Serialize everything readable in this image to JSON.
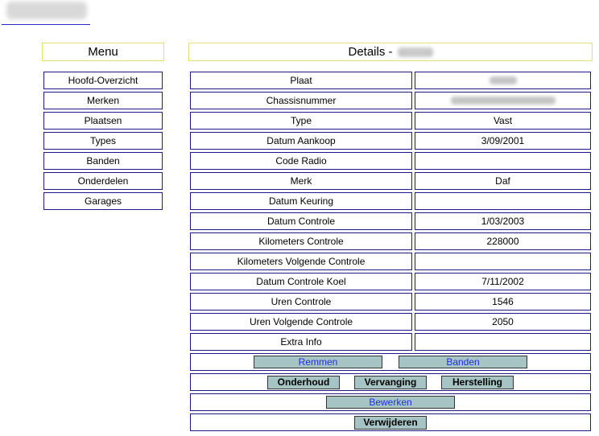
{
  "menu": {
    "title": "Menu",
    "items": [
      "Hoofd-Overzicht",
      "Merken",
      "Plaatsen",
      "Types",
      "Banden",
      "Onderdelen",
      "Garages"
    ]
  },
  "details": {
    "title": "Details -",
    "rows": [
      {
        "label": "Plaat",
        "value": ""
      },
      {
        "label": "Chassisnummer",
        "value": ""
      },
      {
        "label": "Type",
        "value": "Vast"
      },
      {
        "label": "Datum Aankoop",
        "value": "3/09/2001"
      },
      {
        "label": "Code Radio",
        "value": ""
      },
      {
        "label": "Merk",
        "value": "Daf"
      },
      {
        "label": "Datum Keuring",
        "value": ""
      },
      {
        "label": "Datum Controle",
        "value": "1/03/2003"
      },
      {
        "label": "Kilometers Controle",
        "value": "228000"
      },
      {
        "label": "Kilometers Volgende Controle",
        "value": ""
      },
      {
        "label": "Datum Controle Koel",
        "value": "7/11/2002"
      },
      {
        "label": "Uren Controle",
        "value": "1546"
      },
      {
        "label": "Uren Volgende Controle",
        "value": "2050"
      },
      {
        "label": "Extra Info",
        "value": ""
      }
    ]
  },
  "buttons": {
    "remmen": "Remmen",
    "banden": "Banden",
    "onderhoud": "Onderhoud",
    "vervanging": "Vervanging",
    "herstelling": "Herstelling",
    "bewerken": "Bewerken",
    "verwijderen": "Verwijderen"
  }
}
